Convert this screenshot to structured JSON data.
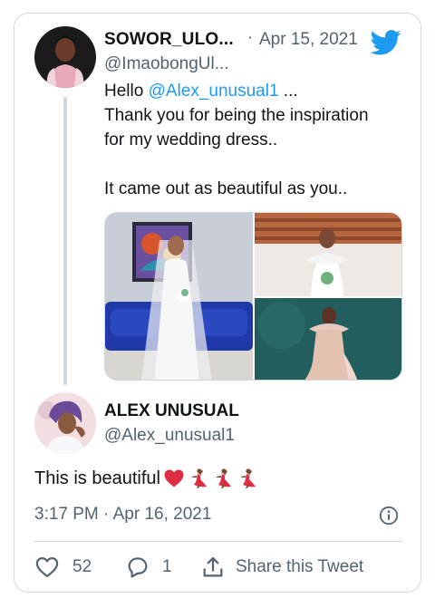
{
  "parent_tweet": {
    "display_name": "SOWOR_ULO...",
    "separator": "·",
    "date": "Apr 15, 2021",
    "handle": "@ImaobongUl...",
    "text": {
      "line1_prefix": "Hello ",
      "line1_mention": "@Alex_unusual1",
      "line1_suffix": " ...",
      "line2": "Thank you for being the inspiration",
      "line3": "for my wedding dress..",
      "line5": "It came out as beautiful as you.."
    },
    "media_icons": [
      "bride-photo-left",
      "bride-photo-top-right",
      "bride-photo-bottom-right"
    ]
  },
  "reply": {
    "display_name": "ALEX UNUSUAL",
    "handle": "@Alex_unusual1",
    "text": "This is beautiful",
    "emoji": [
      "red-heart",
      "dancer",
      "dancer",
      "dancer"
    ],
    "timestamp": "3:17 PM · Apr 16, 2021"
  },
  "actions": {
    "like_count": "52",
    "reply_count": "1",
    "share_label": "Share this Tweet"
  },
  "colors": {
    "link": "#1d9bf0",
    "muted": "#536471",
    "border": "#cfd9de",
    "heart": "#e0245e"
  }
}
